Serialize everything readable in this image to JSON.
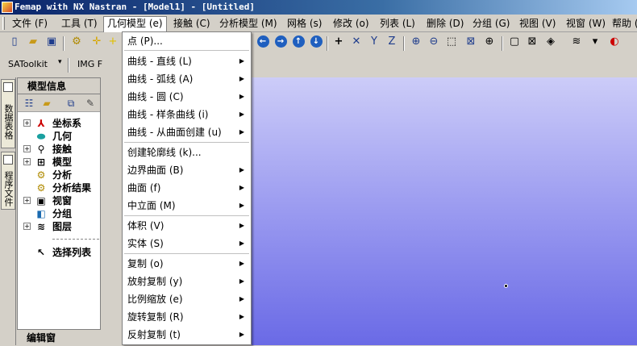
{
  "window": {
    "title": "Femap with NX Nastran - [Model1] - [Untitled]"
  },
  "menubar": {
    "items": [
      {
        "label": "文件 (F)"
      },
      {
        "label": "工具 (T)"
      },
      {
        "label": "几何模型 (e)"
      },
      {
        "label": "接触 (C)"
      },
      {
        "label": "分析模型 (M)"
      },
      {
        "label": "网格 (s)"
      },
      {
        "label": "修改 (o)"
      },
      {
        "label": "列表 (L)"
      },
      {
        "label": "删除 (D)"
      },
      {
        "label": "分组 (G)"
      },
      {
        "label": "视图 (V)"
      },
      {
        "label": "视窗 (W)"
      },
      {
        "label": "帮助 (H)"
      }
    ]
  },
  "toolbar2": {
    "satoolkit": "SAToolkit",
    "img": "IMG F"
  },
  "sidebar_tabs": [
    {
      "label": "数据表格"
    },
    {
      "label": "程序文件"
    }
  ],
  "model_panel": {
    "title": "模型信息",
    "tree": [
      {
        "label": "坐标系",
        "icon": "axes-icon"
      },
      {
        "label": "几何",
        "icon": "cylinder-icon"
      },
      {
        "label": "接触",
        "icon": "magnifier-icon"
      },
      {
        "label": "模型",
        "icon": "grid-icon"
      },
      {
        "label": "分析",
        "icon": "gear-icon"
      },
      {
        "label": "分析结果",
        "icon": "gear-icon"
      },
      {
        "label": "视窗",
        "icon": "window-icon"
      },
      {
        "label": "分组",
        "icon": "group-icon"
      },
      {
        "label": "图层",
        "icon": "layers-icon"
      },
      {
        "label": "选择列表",
        "icon": "cursor-icon"
      }
    ]
  },
  "editor_panel": {
    "title": "编辑窗"
  },
  "dropdown": {
    "items": [
      {
        "label": "点 (P)...",
        "submenu": false
      },
      {
        "label": "曲线 - 直线 (L)",
        "submenu": true
      },
      {
        "label": "曲线 - 弧线 (A)",
        "submenu": true
      },
      {
        "label": "曲线 - 圆 (C)",
        "submenu": true
      },
      {
        "label": "曲线 - 样条曲线 (i)",
        "submenu": true
      },
      {
        "label": "曲线 - 从曲面创建 (u)",
        "submenu": true
      },
      {
        "label": "创建轮廓线 (k)...",
        "submenu": false
      },
      {
        "label": "边界曲面 (B)",
        "submenu": true
      },
      {
        "label": "曲面 (f)",
        "submenu": true
      },
      {
        "label": "中立面 (M)",
        "submenu": true
      },
      {
        "label": "体积 (V)",
        "submenu": true
      },
      {
        "label": "实体 (S)",
        "submenu": true
      },
      {
        "label": "复制 (o)",
        "submenu": true
      },
      {
        "label": "放射复制 (y)",
        "submenu": true
      },
      {
        "label": "比例缩放 (e)",
        "submenu": true
      },
      {
        "label": "旋转复制 (R)",
        "submenu": true
      },
      {
        "label": "反射复制 (t)",
        "submenu": true
      }
    ]
  },
  "colors": {
    "viewport_top": "#ccccf8",
    "viewport_bottom": "#6a6ae6",
    "title_bar": "#0a246a"
  }
}
